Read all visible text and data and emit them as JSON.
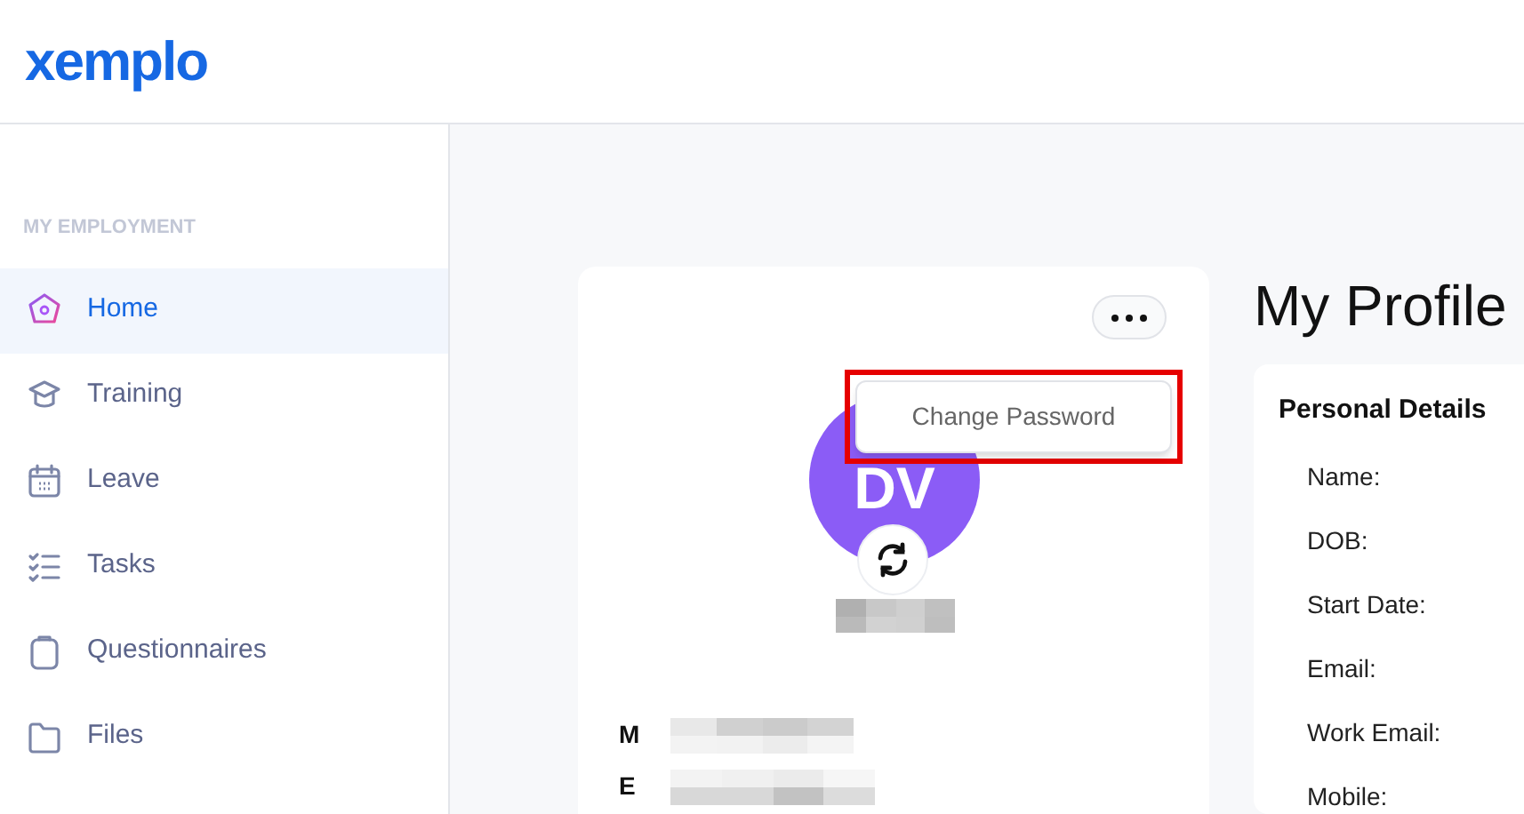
{
  "header": {
    "logo": "xemplo"
  },
  "sidebar": {
    "section": "MY EMPLOYMENT",
    "items": [
      {
        "label": "Home",
        "selected": true
      },
      {
        "label": "Training",
        "selected": false
      },
      {
        "label": "Leave",
        "selected": false
      },
      {
        "label": "Tasks",
        "selected": false
      },
      {
        "label": "Questionnaires",
        "selected": false
      },
      {
        "label": "Files",
        "selected": false
      }
    ]
  },
  "profile_card": {
    "avatar_initials": "DV",
    "menu": {
      "expanded": true,
      "items": [
        "Change Password"
      ]
    },
    "contact_rows": [
      {
        "label": "M"
      },
      {
        "label": "E"
      }
    ]
  },
  "page_title": "My Profile",
  "personal_details": {
    "title": "Personal Details",
    "fields": [
      "Name:",
      "DOB:",
      "Start Date:",
      "Email:",
      "Work Email:",
      "Mobile:"
    ]
  }
}
